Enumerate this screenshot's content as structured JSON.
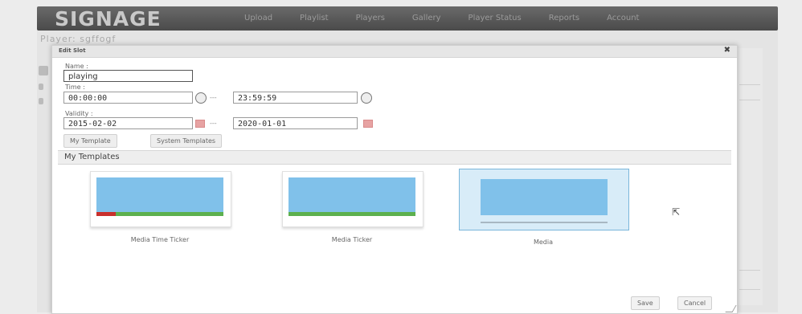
{
  "app": {
    "logo": "SIGNAGE",
    "nav": [
      "Upload",
      "Playlist",
      "Players",
      "Gallery",
      "Player Status",
      "Reports",
      "Account"
    ],
    "page_title": "Player: sgffogf"
  },
  "dialog": {
    "title": "Edit Slot",
    "close_icon": "close-icon",
    "name_label": "Name :",
    "name_value": "playing",
    "time_label": "Time :",
    "time_start": "00:00:00",
    "time_end": "23:59:59",
    "range_sep": "---",
    "validity_label": "Validity :",
    "valid_from": "2015-02-02",
    "valid_to": "2020-01-01",
    "tabs": [
      "My Template",
      "System Templates"
    ],
    "section_title": "My Templates",
    "templates": [
      {
        "caption": "Media Time Ticker",
        "selected": false
      },
      {
        "caption": "Media Ticker",
        "selected": false
      },
      {
        "caption": "Media",
        "selected": true
      }
    ],
    "save_label": "Save",
    "cancel_label": "Cancel"
  },
  "colors": {
    "screen": "#80c1ea",
    "ticker": "#5cb04e",
    "time": "#c9302c",
    "selected_bg": "#d8ecf8"
  }
}
